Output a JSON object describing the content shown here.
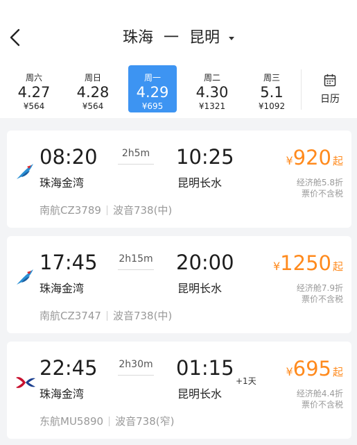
{
  "header": {
    "origin": "珠海",
    "separator": "一",
    "destination": "昆明"
  },
  "dates": [
    {
      "weekday": "周六",
      "date": "4.27",
      "price": "¥564",
      "selected": false
    },
    {
      "weekday": "周日",
      "date": "4.28",
      "price": "¥564",
      "selected": false
    },
    {
      "weekday": "周一",
      "date": "4.29",
      "price": "¥695",
      "selected": true
    },
    {
      "weekday": "周二",
      "date": "4.30",
      "price": "¥1321",
      "selected": false
    },
    {
      "weekday": "周三",
      "date": "5.1",
      "price": "¥1092",
      "selected": false
    }
  ],
  "calendar": {
    "label": "日历",
    "icon": "calendar-icon"
  },
  "flights": [
    {
      "airline_icon": "china-southern-logo-icon",
      "dep_time": "08:20",
      "dep_airport": "珠海金湾",
      "duration": "2h5m",
      "arr_time": "10:25",
      "arr_airport": "昆明长水",
      "next_day": "",
      "currency": "¥",
      "price": "920",
      "price_suffix": "起",
      "discount": "经济舱5.8折",
      "tax_note": "票价不含税",
      "flight_no": "南航CZ3789",
      "aircraft": "波音738(中)"
    },
    {
      "airline_icon": "china-southern-logo-icon",
      "dep_time": "17:45",
      "dep_airport": "珠海金湾",
      "duration": "2h15m",
      "arr_time": "20:00",
      "arr_airport": "昆明长水",
      "next_day": "",
      "currency": "¥",
      "price": "1250",
      "price_suffix": "起",
      "discount": "经济舱7.9折",
      "tax_note": "票价不含税",
      "flight_no": "南航CZ3747",
      "aircraft": "波音738(中)"
    },
    {
      "airline_icon": "china-eastern-logo-icon",
      "dep_time": "22:45",
      "dep_airport": "珠海金湾",
      "duration": "2h30m",
      "arr_time": "01:15",
      "arr_airport": "昆明长水",
      "next_day": "+1天",
      "currency": "¥",
      "price": "695",
      "price_suffix": "起",
      "discount": "经济舱4.4折",
      "tax_note": "票价不含税",
      "flight_no": "东航MU5890",
      "aircraft": "波音738(窄)"
    }
  ],
  "colors": {
    "accent": "#3d94f2",
    "price": "#ff8a1d",
    "muted": "#999999",
    "background": "#f3f4f6"
  }
}
